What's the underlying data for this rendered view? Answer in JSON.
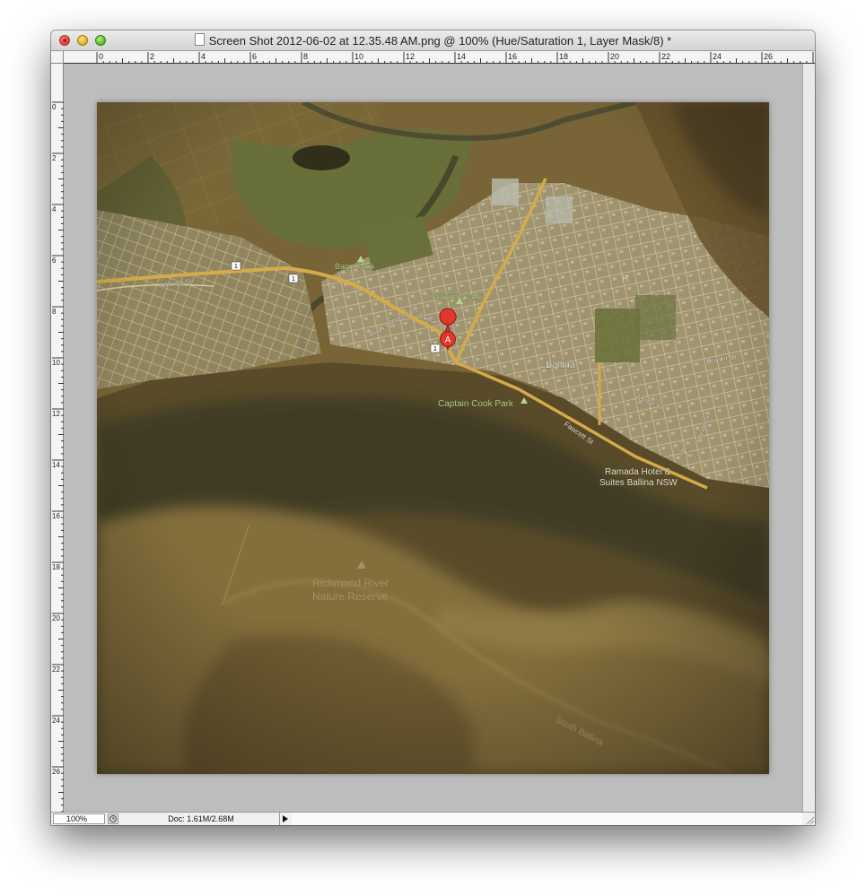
{
  "window": {
    "title": "Screen Shot 2012-06-02 at 12.35.48 AM.png @ 100% (Hue/Saturation 1, Layer Mask/8) *"
  },
  "rulers": {
    "horizontal": [
      "0",
      "2",
      "4",
      "6",
      "8",
      "10",
      "12",
      "14",
      "16",
      "18",
      "20",
      "22",
      "24",
      "26"
    ],
    "vertical": [
      "0",
      "2",
      "4",
      "6",
      "8",
      "10",
      "12",
      "14",
      "16",
      "18",
      "20",
      "22",
      "24",
      "26"
    ]
  },
  "map": {
    "labels": {
      "bagot_park": "Bagot Park",
      "saunders_park": "Saunders Park",
      "ballina": "Ballina",
      "captain_cook_park": "Captain Cook Park",
      "ramada_1": "Ramada Hotel &",
      "ramada_2": "Suites Ballina NSW",
      "nature_1": "Richmond River",
      "nature_2": "Nature Reserve",
      "kalinga_st": "Kalinga St",
      "tamar_st": "Tamar St",
      "river_st": "River St",
      "winton_ln": "Winton Ln",
      "fawcett_st": "Fawcett St",
      "tamar_st_2": "Tamar St",
      "river_st_2": "River St",
      "norton_st": "Norton St",
      "burnet_st": "Burnet St",
      "south_ballina": "South Ballina",
      "marker": "A",
      "route_1": "1"
    }
  },
  "status": {
    "zoom": "100%",
    "doc_info": "Doc: 1.61M/2.68M"
  },
  "colors": {
    "canvas_bg": "#bdbdbd",
    "map_land": "#7a6a3e",
    "map_water": "#3e3a28",
    "road": "#d8b04c",
    "marker": "#e2372c"
  }
}
